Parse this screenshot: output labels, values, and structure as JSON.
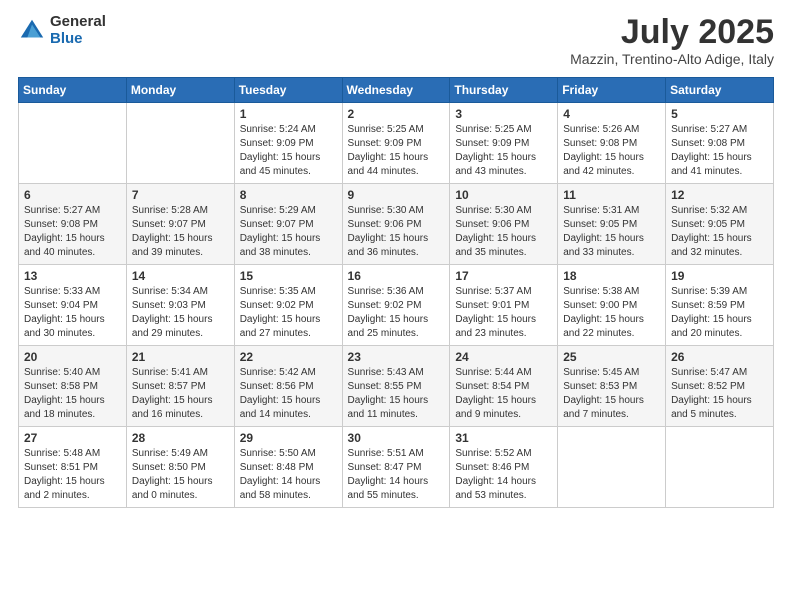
{
  "logo": {
    "general": "General",
    "blue": "Blue"
  },
  "title": "July 2025",
  "subtitle": "Mazzin, Trentino-Alto Adige, Italy",
  "days_of_week": [
    "Sunday",
    "Monday",
    "Tuesday",
    "Wednesday",
    "Thursday",
    "Friday",
    "Saturday"
  ],
  "weeks": [
    [
      {
        "day": "",
        "info": ""
      },
      {
        "day": "",
        "info": ""
      },
      {
        "day": "1",
        "info": "Sunrise: 5:24 AM\nSunset: 9:09 PM\nDaylight: 15 hours\nand 45 minutes."
      },
      {
        "day": "2",
        "info": "Sunrise: 5:25 AM\nSunset: 9:09 PM\nDaylight: 15 hours\nand 44 minutes."
      },
      {
        "day": "3",
        "info": "Sunrise: 5:25 AM\nSunset: 9:09 PM\nDaylight: 15 hours\nand 43 minutes."
      },
      {
        "day": "4",
        "info": "Sunrise: 5:26 AM\nSunset: 9:08 PM\nDaylight: 15 hours\nand 42 minutes."
      },
      {
        "day": "5",
        "info": "Sunrise: 5:27 AM\nSunset: 9:08 PM\nDaylight: 15 hours\nand 41 minutes."
      }
    ],
    [
      {
        "day": "6",
        "info": "Sunrise: 5:27 AM\nSunset: 9:08 PM\nDaylight: 15 hours\nand 40 minutes."
      },
      {
        "day": "7",
        "info": "Sunrise: 5:28 AM\nSunset: 9:07 PM\nDaylight: 15 hours\nand 39 minutes."
      },
      {
        "day": "8",
        "info": "Sunrise: 5:29 AM\nSunset: 9:07 PM\nDaylight: 15 hours\nand 38 minutes."
      },
      {
        "day": "9",
        "info": "Sunrise: 5:30 AM\nSunset: 9:06 PM\nDaylight: 15 hours\nand 36 minutes."
      },
      {
        "day": "10",
        "info": "Sunrise: 5:30 AM\nSunset: 9:06 PM\nDaylight: 15 hours\nand 35 minutes."
      },
      {
        "day": "11",
        "info": "Sunrise: 5:31 AM\nSunset: 9:05 PM\nDaylight: 15 hours\nand 33 minutes."
      },
      {
        "day": "12",
        "info": "Sunrise: 5:32 AM\nSunset: 9:05 PM\nDaylight: 15 hours\nand 32 minutes."
      }
    ],
    [
      {
        "day": "13",
        "info": "Sunrise: 5:33 AM\nSunset: 9:04 PM\nDaylight: 15 hours\nand 30 minutes."
      },
      {
        "day": "14",
        "info": "Sunrise: 5:34 AM\nSunset: 9:03 PM\nDaylight: 15 hours\nand 29 minutes."
      },
      {
        "day": "15",
        "info": "Sunrise: 5:35 AM\nSunset: 9:02 PM\nDaylight: 15 hours\nand 27 minutes."
      },
      {
        "day": "16",
        "info": "Sunrise: 5:36 AM\nSunset: 9:02 PM\nDaylight: 15 hours\nand 25 minutes."
      },
      {
        "day": "17",
        "info": "Sunrise: 5:37 AM\nSunset: 9:01 PM\nDaylight: 15 hours\nand 23 minutes."
      },
      {
        "day": "18",
        "info": "Sunrise: 5:38 AM\nSunset: 9:00 PM\nDaylight: 15 hours\nand 22 minutes."
      },
      {
        "day": "19",
        "info": "Sunrise: 5:39 AM\nSunset: 8:59 PM\nDaylight: 15 hours\nand 20 minutes."
      }
    ],
    [
      {
        "day": "20",
        "info": "Sunrise: 5:40 AM\nSunset: 8:58 PM\nDaylight: 15 hours\nand 18 minutes."
      },
      {
        "day": "21",
        "info": "Sunrise: 5:41 AM\nSunset: 8:57 PM\nDaylight: 15 hours\nand 16 minutes."
      },
      {
        "day": "22",
        "info": "Sunrise: 5:42 AM\nSunset: 8:56 PM\nDaylight: 15 hours\nand 14 minutes."
      },
      {
        "day": "23",
        "info": "Sunrise: 5:43 AM\nSunset: 8:55 PM\nDaylight: 15 hours\nand 11 minutes."
      },
      {
        "day": "24",
        "info": "Sunrise: 5:44 AM\nSunset: 8:54 PM\nDaylight: 15 hours\nand 9 minutes."
      },
      {
        "day": "25",
        "info": "Sunrise: 5:45 AM\nSunset: 8:53 PM\nDaylight: 15 hours\nand 7 minutes."
      },
      {
        "day": "26",
        "info": "Sunrise: 5:47 AM\nSunset: 8:52 PM\nDaylight: 15 hours\nand 5 minutes."
      }
    ],
    [
      {
        "day": "27",
        "info": "Sunrise: 5:48 AM\nSunset: 8:51 PM\nDaylight: 15 hours\nand 2 minutes."
      },
      {
        "day": "28",
        "info": "Sunrise: 5:49 AM\nSunset: 8:50 PM\nDaylight: 15 hours\nand 0 minutes."
      },
      {
        "day": "29",
        "info": "Sunrise: 5:50 AM\nSunset: 8:48 PM\nDaylight: 14 hours\nand 58 minutes."
      },
      {
        "day": "30",
        "info": "Sunrise: 5:51 AM\nSunset: 8:47 PM\nDaylight: 14 hours\nand 55 minutes."
      },
      {
        "day": "31",
        "info": "Sunrise: 5:52 AM\nSunset: 8:46 PM\nDaylight: 14 hours\nand 53 minutes."
      },
      {
        "day": "",
        "info": ""
      },
      {
        "day": "",
        "info": ""
      }
    ]
  ]
}
